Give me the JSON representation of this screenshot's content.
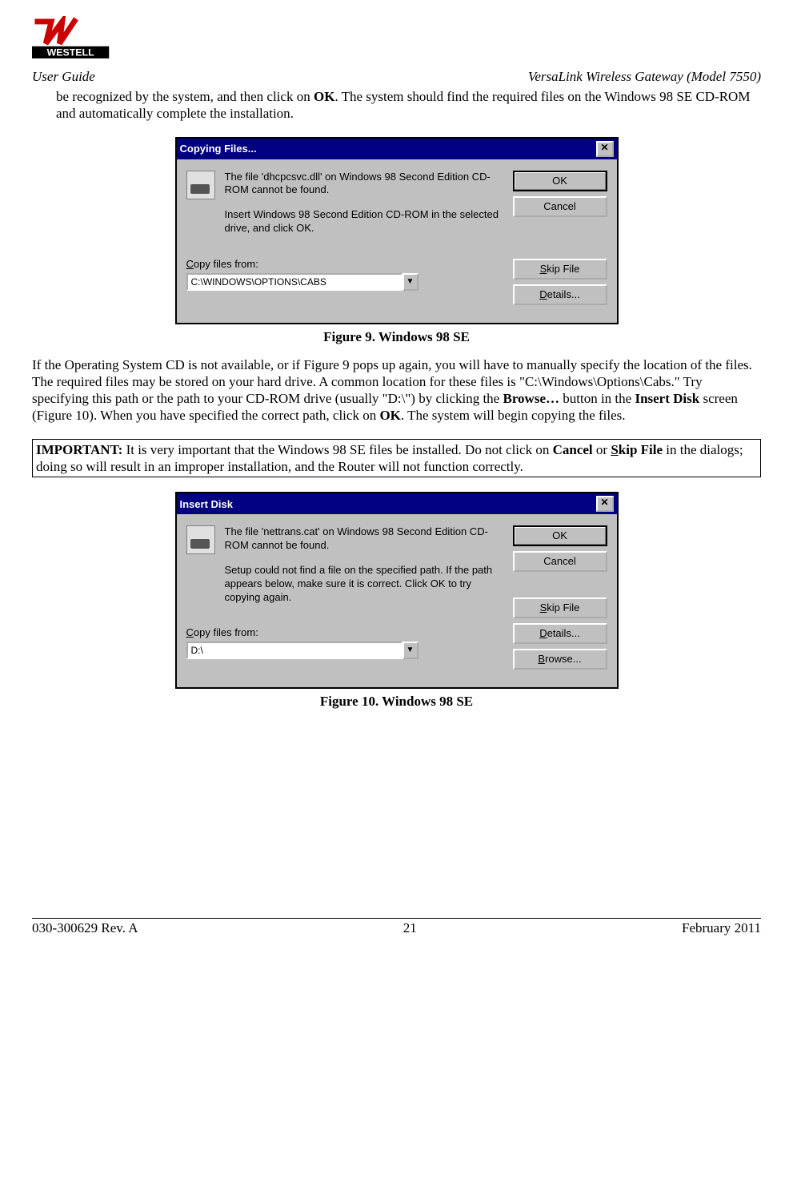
{
  "brand": "WESTELL",
  "header": {
    "left": "User Guide",
    "right": "VersaLink Wireless Gateway (Model 7550)"
  },
  "intro": {
    "pre": "be recognized by the system, and then click on ",
    "ok": "OK",
    "post": ". The system should find the required files on the Windows 98 SE CD-ROM and automatically complete the installation."
  },
  "dialog1": {
    "title": "Copying Files...",
    "line1": "The file 'dhcpcsvc.dll' on Windows 98 Second Edition CD-ROM cannot be found.",
    "line2": "Insert Windows 98 Second Edition CD-ROM in the selected drive, and click OK.",
    "copy_label_u": "C",
    "copy_label_rest": "opy files from:",
    "path": "C:\\WINDOWS\\OPTIONS\\CABS",
    "buttons": {
      "ok": "OK",
      "cancel": "Cancel",
      "skip_u": "S",
      "skip_rest": "kip File",
      "details_u": "D",
      "details_rest": "etails..."
    }
  },
  "caption1": "Figure 9.  Windows 98 SE",
  "para2": {
    "p1": "If the Operating System CD is not available, or if Figure 9 pops up again, you will have to manually specify the location of the files. The required files may be stored on your hard drive. A common location for these files is \"C:\\Windows\\Options\\Cabs.\" Try specifying this path or the path to your CD-ROM drive (usually \"D:\\\") by clicking the ",
    "browse": "Browse…",
    "p2": " button in the ",
    "insert": "Insert Disk",
    "p3": " screen (Figure 10). When you have specified the correct path, click on ",
    "ok": "OK",
    "p4": ". The system will begin copying the files."
  },
  "important": {
    "label": "IMPORTANT:",
    "pre": " It is very important that the Windows 98 SE files be installed. Do not click on ",
    "cancel": "Cancel",
    "or": " or ",
    "skip_u": "S",
    "skip_rest": "kip File",
    "post": " in the dialogs; doing so will result in an improper installation, and the Router will not function correctly."
  },
  "dialog2": {
    "title": "Insert Disk",
    "line1": "The file 'nettrans.cat' on Windows 98 Second Edition CD-ROM cannot be found.",
    "line2": "Setup could not find a file on the specified path. If the path appears below, make sure it is correct. Click OK to try copying again.",
    "copy_label_u": "C",
    "copy_label_rest": "opy files from:",
    "path": "D:\\",
    "buttons": {
      "ok": "OK",
      "cancel": "Cancel",
      "skip_u": "S",
      "skip_rest": "kip File",
      "details_u": "D",
      "details_rest": "etails...",
      "browse_u": "B",
      "browse_rest": "rowse..."
    }
  },
  "caption2": "Figure 10. Windows 98 SE",
  "footer": {
    "left": "030-300629 Rev. A",
    "center": "21",
    "right": "February 2011"
  }
}
